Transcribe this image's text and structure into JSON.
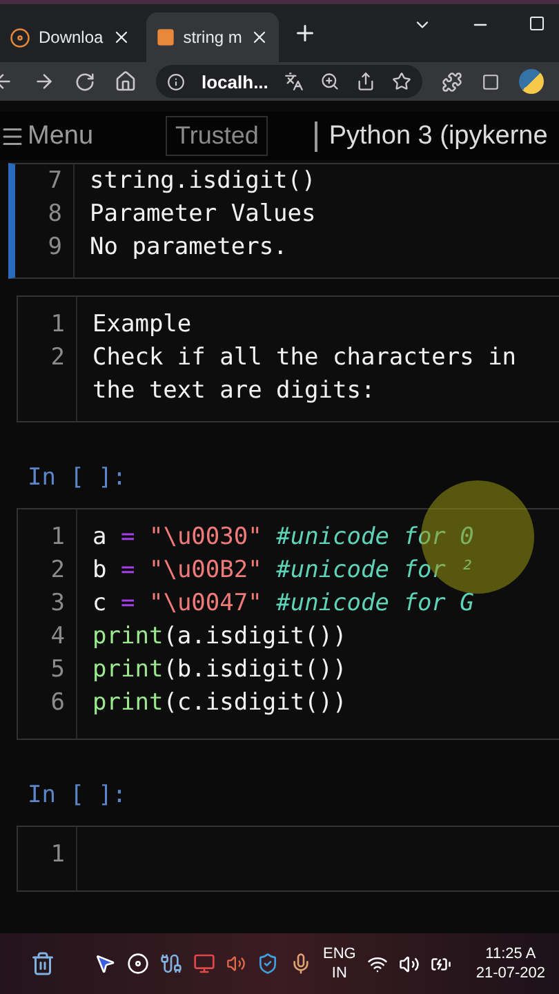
{
  "browser": {
    "tabs": [
      {
        "label": "Downloa",
        "selected": false
      },
      {
        "label": "string m",
        "selected": true
      }
    ],
    "address": "localh..."
  },
  "notebook": {
    "menu": "Menu",
    "trusted": "Trusted",
    "kernel": "Python 3 (ipykerne",
    "cells": [
      {
        "kind": "markdown",
        "selected": true,
        "lines": [
          {
            "number": "7",
            "tokens": [
              {
                "kind": "plain",
                "text": "string.isdigit()"
              }
            ]
          },
          {
            "number": "8",
            "tokens": [
              {
                "kind": "plain",
                "text": "Parameter Values"
              }
            ]
          },
          {
            "number": "9",
            "tokens": [
              {
                "kind": "plain",
                "text": "No parameters."
              }
            ]
          }
        ]
      },
      {
        "kind": "markdown",
        "selected": false,
        "lines": [
          {
            "number": "1",
            "tokens": [
              {
                "kind": "plain",
                "text": "Example"
              }
            ]
          },
          {
            "number": "2",
            "tokens": [
              {
                "kind": "plain",
                "text": "Check if all the characters in the text are digits:"
              }
            ]
          }
        ]
      },
      {
        "kind": "prompt",
        "text": "In [ ]:"
      },
      {
        "kind": "code",
        "selected": false,
        "lines": [
          {
            "number": "1",
            "tokens": [
              {
                "kind": "plain",
                "text": "a "
              },
              {
                "kind": "op",
                "text": "="
              },
              {
                "kind": "string",
                "text": " \"\\u0030\""
              },
              {
                "kind": "comment",
                "text": " #unicode for 0"
              }
            ]
          },
          {
            "number": "2",
            "tokens": [
              {
                "kind": "plain",
                "text": "b "
              },
              {
                "kind": "op",
                "text": "="
              },
              {
                "kind": "string",
                "text": " \"\\u00B2\""
              },
              {
                "kind": "comment",
                "text": " #unicode for ²"
              }
            ]
          },
          {
            "number": "3",
            "tokens": [
              {
                "kind": "plain",
                "text": "c "
              },
              {
                "kind": "op",
                "text": "="
              },
              {
                "kind": "string",
                "text": " \"\\u0047\""
              },
              {
                "kind": "comment",
                "text": " #unicode for G"
              }
            ]
          },
          {
            "number": "4",
            "tokens": [
              {
                "kind": "builtin",
                "text": "print"
              },
              {
                "kind": "plain",
                "text": "(a.isdigit())"
              }
            ]
          },
          {
            "number": "5",
            "tokens": [
              {
                "kind": "builtin",
                "text": "print"
              },
              {
                "kind": "plain",
                "text": "(b.isdigit())"
              }
            ]
          },
          {
            "number": "6",
            "tokens": [
              {
                "kind": "builtin",
                "text": "print"
              },
              {
                "kind": "plain",
                "text": "(c.isdigit())"
              }
            ]
          }
        ]
      },
      {
        "kind": "prompt",
        "text": "In [ ]:"
      },
      {
        "kind": "code",
        "selected": false,
        "lines": [
          {
            "number": "1"
          }
        ]
      }
    ]
  },
  "taskbar": {
    "language": "ENG",
    "region": "IN",
    "time": "11:25 A",
    "date": "21-07-202"
  }
}
